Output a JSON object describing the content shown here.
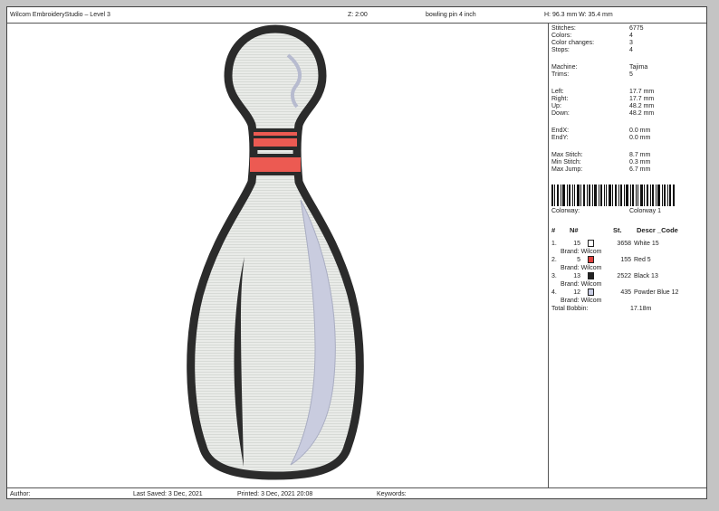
{
  "header": {
    "app_title": "Wilcom EmbroideryStudio – Level 3",
    "zoom": "Z: 2:00",
    "design_name": "bowling pin 4 inch",
    "size": "H: 96.3 mm   W: 35.4 mm"
  },
  "info": [
    {
      "label": "Stitches:",
      "value": "6775"
    },
    {
      "label": "Colors:",
      "value": "4"
    },
    {
      "label": "Color changes:",
      "value": "3"
    },
    {
      "label": "Stops:",
      "value": "4"
    },
    {
      "label": "Machine:",
      "value": "Tajima"
    },
    {
      "label": "Trims:",
      "value": "5"
    },
    {
      "label": "Left:",
      "value": "17.7 mm"
    },
    {
      "label": "Right:",
      "value": "17.7 mm"
    },
    {
      "label": "Up:",
      "value": "48.2 mm"
    },
    {
      "label": "Down:",
      "value": "48.2 mm"
    },
    {
      "label": "EndX:",
      "value": "0.0 mm"
    },
    {
      "label": "EndY:",
      "value": "0.0 mm"
    },
    {
      "label": "Max Stitch:",
      "value": "8.7 mm"
    },
    {
      "label": "Min Stitch:",
      "value": "0.3 mm"
    },
    {
      "label": "Max Jump:",
      "value": "6.7 mm"
    }
  ],
  "colorway": {
    "label": "Colorway:",
    "value": "Colorway 1"
  },
  "threads_header": {
    "idx": "#",
    "n": "N#",
    "st": "St.",
    "desc": "Descr _Code"
  },
  "threads": [
    {
      "idx": "1.",
      "n": "15",
      "color": "#ffffff",
      "st": "3658",
      "desc": "White 15",
      "brand": "Brand: Wilcom"
    },
    {
      "idx": "2.",
      "n": "5",
      "color": "#e0403c",
      "st": "155",
      "desc": "Red 5",
      "brand": "Brand: Wilcom"
    },
    {
      "idx": "3.",
      "n": "13",
      "color": "#222222",
      "st": "2522",
      "desc": "Black 13",
      "brand": "Brand: Wilcom"
    },
    {
      "idx": "4.",
      "n": "12",
      "color": "#c8cde4",
      "st": "435",
      "desc": "Powder Blue 12",
      "brand": "Brand: Wilcom"
    }
  ],
  "bobbin": {
    "label": "Total Bobbin:",
    "value": "17.18m"
  },
  "footer": {
    "author": "Author:",
    "last_saved": "Last Saved:  3 Dec, 2021",
    "printed": "Printed:  3 Dec, 2021 20:08",
    "keywords": "Keywords:"
  },
  "colors": {
    "outline": "#2b2b2b",
    "fill": "#e9ebe8",
    "accent": "#ec5a52",
    "highlight": "#c9ccdf"
  }
}
